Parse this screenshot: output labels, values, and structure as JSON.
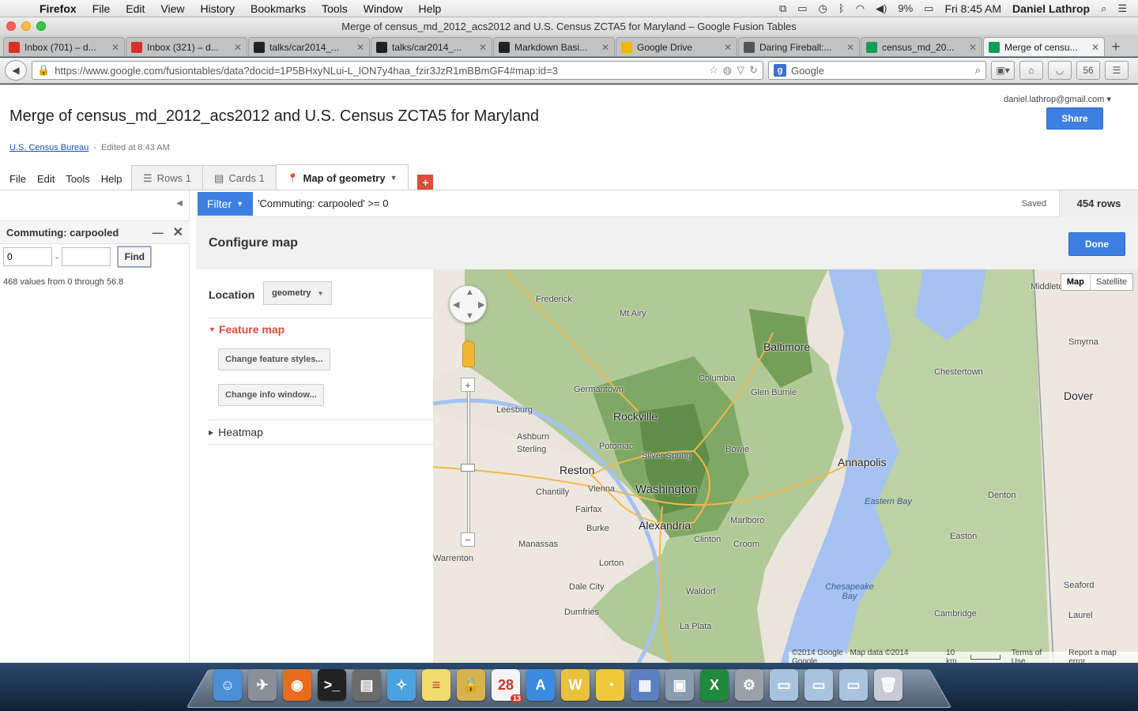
{
  "menubar": {
    "app_name": "Firefox",
    "items": [
      "File",
      "Edit",
      "View",
      "History",
      "Bookmarks",
      "Tools",
      "Window",
      "Help"
    ],
    "battery": "9%",
    "clock": "Fri 8:45 AM",
    "user": "Daniel Lathrop"
  },
  "window": {
    "title": "Merge of census_md_2012_acs2012 and U.S. Census ZCTA5 for Maryland – Google Fusion Tables"
  },
  "browser_tabs": [
    {
      "label": "Inbox (701) – d...",
      "icon": "gmail-icon",
      "color": "#d93025"
    },
    {
      "label": "Inbox (321) – d...",
      "icon": "gmail-icon",
      "color": "#d93025"
    },
    {
      "label": "talks/car2014_...",
      "icon": "github-icon",
      "color": "#222222"
    },
    {
      "label": "talks/car2014_...",
      "icon": "github-icon",
      "color": "#222222"
    },
    {
      "label": "Markdown Basi...",
      "icon": "github-icon",
      "color": "#222222"
    },
    {
      "label": "Google Drive",
      "icon": "drive-icon",
      "color": "#f4b400"
    },
    {
      "label": "Daring Fireball:...",
      "icon": "star-icon",
      "color": "#555555"
    },
    {
      "label": "census_md_20...",
      "icon": "fusion-tables-icon",
      "color": "#0f9d58"
    },
    {
      "label": "Merge of censu...",
      "icon": "fusion-tables-icon",
      "color": "#0f9d58"
    }
  ],
  "navbar": {
    "url": "https://www.google.com/fusiontables/data?docid=1P5BHxyNLui-L_lON7y4haa_fzir3JzR1mBBmGF4#map:id=3",
    "search_placeholder": "Google"
  },
  "page": {
    "account": "daniel.lathrop@gmail.com",
    "share_label": "Share",
    "title": "Merge of census_md_2012_acs2012 and U.S. Census ZCTA5 for Maryland",
    "source_link": "U.S. Census Bureau",
    "edited": "Edited at 8:43 AM",
    "app_menu": [
      "File",
      "Edit",
      "Tools",
      "Help"
    ],
    "view_tabs": [
      {
        "label": "Rows 1",
        "icon": "rows-icon"
      },
      {
        "label": "Cards 1",
        "icon": "cards-icon"
      },
      {
        "label": "Map of geometry",
        "icon": "map-pin-icon"
      }
    ],
    "add_tab_label": "+"
  },
  "filter_panel": {
    "column": "Commuting: carpooled",
    "min_value": "0",
    "max_value": "",
    "find_label": "Find",
    "info": "468 values from 0 through 56.8"
  },
  "filter_bar": {
    "button_label": "Filter",
    "expression": "'Commuting: carpooled' >= 0",
    "status": "Saved",
    "row_count": "454 rows"
  },
  "configure": {
    "title": "Configure map",
    "done_label": "Done",
    "location_label": "Location",
    "location_value": "geometry",
    "feature_map_label": "Feature map",
    "change_styles_label": "Change feature styles...",
    "change_info_label": "Change info window...",
    "heatmap_label": "Heatmap"
  },
  "map": {
    "map_type": [
      "Map",
      "Satellite"
    ],
    "labels": {
      "baltimore": "Baltimore",
      "washington": "Washington",
      "alexandria": "Alexandria",
      "annapolis": "Annapolis",
      "rockville": "Rockville",
      "dover": "Dover",
      "frederick": "Frederick",
      "leesburg": "Leesburg",
      "reston": "Reston",
      "fairfax": "Fairfax",
      "chantilly": "Chantilly",
      "vienna": "Vienna",
      "burke": "Burke",
      "manassas": "Manassas",
      "lorton": "Lorton",
      "dale_city": "Dale City",
      "dumfries": "Dumfries",
      "warrenton": "Warrenton",
      "ashburn": "Ashburn",
      "sterling": "Sterling",
      "chestertown": "Chestertown",
      "easton": "Easton",
      "denton": "Denton",
      "cambridge": "Cambridge",
      "seaford": "Seaford",
      "laurel": "Laurel",
      "smyrna": "Smyrna",
      "middletown": "Middletown",
      "chesapeake_bay": "Chesapeake Bay",
      "eastern_bay": "Eastern Bay",
      "germantown": "Germantown",
      "silver_spring": "Silver Spring",
      "columbia": "Columbia",
      "mt_airy": "Mt Airy",
      "glen_burnie": "Glen Burnie",
      "bowie": "Bowie",
      "waldorf": "Waldorf",
      "la_plata": "La Plata",
      "clinton": "Clinton",
      "potomac": "Potomac",
      "croom": "Croom",
      "marlboro": "Marlboro"
    },
    "attribution": "©2014 Google - Map data ©2014 Google",
    "scale": "10 km",
    "terms": "Terms of Use",
    "report": "Report a map error"
  },
  "dock": {
    "items": [
      {
        "name": "finder-icon",
        "color": "#4a8fd8",
        "glyph": "☺"
      },
      {
        "name": "launchpad-icon",
        "color": "#8a8f99",
        "glyph": "✈"
      },
      {
        "name": "firefox-icon",
        "color": "#e86c1c",
        "glyph": "◉"
      },
      {
        "name": "terminal-icon",
        "color": "#222222",
        "glyph": ">_"
      },
      {
        "name": "photo-booth-icon",
        "color": "#6b6b6b",
        "glyph": "▤"
      },
      {
        "name": "safari-icon",
        "color": "#4aa3df",
        "glyph": "✧"
      },
      {
        "name": "stickies-icon",
        "color": "#f2dc6e",
        "glyph": "≡"
      },
      {
        "name": "keychain-icon",
        "color": "#d8b24a",
        "glyph": "🔒"
      },
      {
        "name": "calendar-icon",
        "color": "#f4f4f4",
        "glyph": "28"
      },
      {
        "name": "app-store-icon",
        "color": "#3b8be0",
        "glyph": "A"
      },
      {
        "name": "transmit-icon",
        "color": "#e8c23a",
        "glyph": "W"
      },
      {
        "name": "cyberduck-icon",
        "color": "#f0c83a",
        "glyph": "◔"
      },
      {
        "name": "dashboard-icon",
        "color": "#5b7fc4",
        "glyph": "▦"
      },
      {
        "name": "preview-icon",
        "color": "#8a9bb0",
        "glyph": "▣"
      },
      {
        "name": "excel-icon",
        "color": "#1f8a3c",
        "glyph": "X"
      },
      {
        "name": "system-prefs-icon",
        "color": "#9aa0a8",
        "glyph": "⚙"
      },
      {
        "name": "folder-icon",
        "color": "#a9c3de",
        "glyph": "▭"
      },
      {
        "name": "documents-icon",
        "color": "#a9c3de",
        "glyph": "▭"
      },
      {
        "name": "downloads-icon",
        "color": "#a9c3de",
        "glyph": "▭"
      },
      {
        "name": "trash-icon",
        "color": "#c8ccd2",
        "glyph": "🗑"
      }
    ],
    "calendar_badge": "13"
  }
}
